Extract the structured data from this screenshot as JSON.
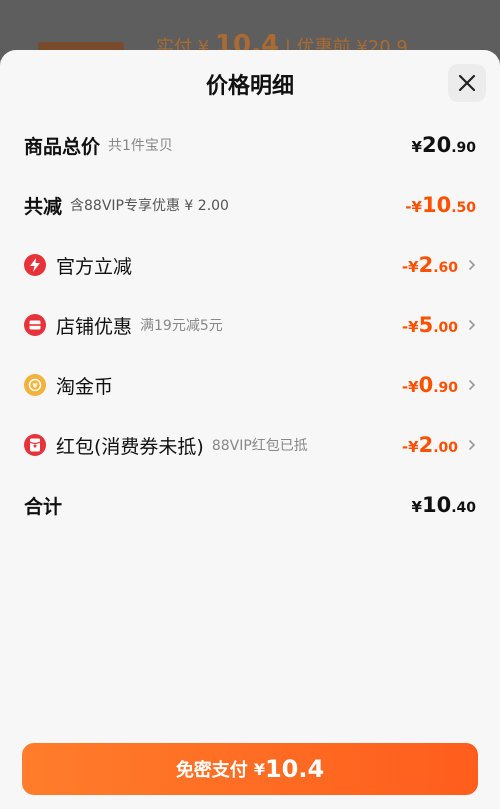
{
  "background": {
    "paid_label": "实付",
    "paid_symbol": "¥",
    "paid_amount": "10.4",
    "original_label": "优惠前 ¥20.9"
  },
  "sheet": {
    "title": "价格明细",
    "close_icon": "close-icon"
  },
  "rows": [
    {
      "label": "商品总价",
      "note": "共1件宝贝",
      "sym": "¥",
      "int": "20",
      "dec": ".90",
      "tone": "black"
    },
    {
      "label": "共减",
      "note": "含88VIP专享优惠 ¥ 2.00",
      "sym": "-¥",
      "int": "10",
      "dec": ".50",
      "tone": "orange"
    },
    {
      "label": "官方立减",
      "note": "",
      "sym": "-¥",
      "int": "2",
      "dec": ".60",
      "tone": "orange",
      "icon": "lightning-icon"
    },
    {
      "label": "店铺优惠",
      "note": "满19元减5元",
      "sym": "-¥",
      "int": "5",
      "dec": ".00",
      "tone": "orange",
      "icon": "coupon-icon"
    },
    {
      "label": "淘金币",
      "note": "",
      "sym": "-¥",
      "int": "0",
      "dec": ".90",
      "tone": "orange",
      "icon": "gold-coin-icon"
    },
    {
      "label": "红包(消费券未抵)",
      "note": "88VIP红包已抵",
      "sym": "-¥",
      "int": "2",
      "dec": ".00",
      "tone": "orange",
      "icon": "red-packet-icon"
    },
    {
      "label": "合计",
      "note": "",
      "sym": "¥",
      "int": "10",
      "dec": ".40",
      "tone": "black"
    }
  ],
  "pay_button": {
    "label": "免密支付",
    "sym": "¥",
    "amount": "10.4"
  },
  "colors": {
    "accent": "#ff5000",
    "button": "#ff6b22",
    "icon_red": "#e8323a",
    "icon_gold": "#f3b23c"
  }
}
